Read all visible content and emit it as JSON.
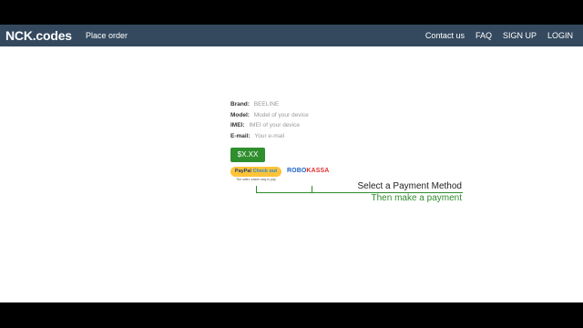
{
  "navbar": {
    "brand": "NCK.codes",
    "place_order": "Place order",
    "links": [
      "Contact us",
      "FAQ",
      "SIGN UP",
      "LOGIN"
    ]
  },
  "form": {
    "brand_label": "Brand:",
    "brand_value": "BEELINE",
    "model_label": "Model:",
    "model_placeholder": "Model of your device",
    "imei_label": "IMEI:",
    "imei_placeholder": "IMEI of your device",
    "email_label": "E-mail:",
    "email_placeholder": "Your e-mail"
  },
  "price_button": "$X.XX",
  "payment": {
    "paypal_brand": "PayPal",
    "paypal_action": "Check out",
    "paypal_tagline": "The safer, easier way to pay",
    "robokassa_part1": "ROBO",
    "robokassa_part2": "KASSA"
  },
  "annotation": {
    "line1": "Select a Payment Method",
    "line2": "Then make a payment"
  },
  "colors": {
    "navbar": "#34495e",
    "accent_green": "#2e8b2e",
    "paypal_yellow": "#ffc439"
  }
}
